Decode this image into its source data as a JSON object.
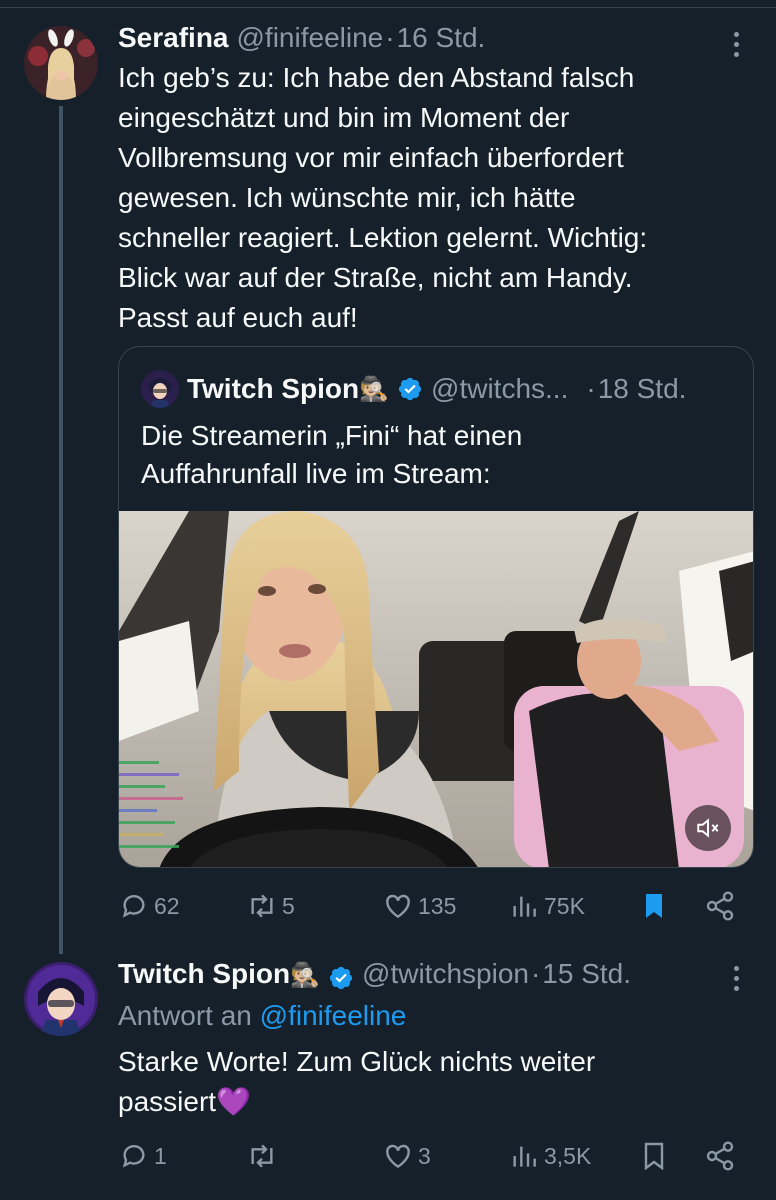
{
  "main_tweet": {
    "name": "Serafina",
    "handle": "@finifeeline",
    "sep": "·",
    "time": "16 Std.",
    "text_lines": [
      "Ich geb’s zu: Ich habe den Abstand falsch",
      "eingeschätzt und bin im Moment der",
      "Vollbremsung vor mir einfach überfordert",
      "gewesen. Ich wünschte mir, ich hätte",
      "schneller reagiert. Lektion gelernt. Wichtig:",
      "Blick war auf der Straße, nicht am Handy.",
      "Passt auf euch auf!"
    ],
    "quote": {
      "name": "Twitch Spion",
      "emoji": "🕵🏼",
      "handle": "@twitchs...",
      "sep": "·",
      "time": "18 Std.",
      "text_lines": [
        "Die Streamerin „Fini“ hat einen",
        "Auffahrunfall live im Stream:"
      ]
    },
    "actions": {
      "replies": "62",
      "retweets": "5",
      "likes": "135",
      "views": "75K"
    }
  },
  "reply_tweet": {
    "name": "Twitch Spion",
    "emoji": "🕵🏼",
    "handle": "@twitchspion",
    "sep": "·",
    "time": "15 Std.",
    "reply_prefix": "Antwort an",
    "reply_handle": "@finifeeline",
    "text_lines": [
      "Starke Worte! Zum Glück nichts weiter",
      "passiert💜"
    ],
    "actions": {
      "replies": "1",
      "retweets": "",
      "likes": "3",
      "views": "3,5K"
    }
  },
  "colors": {
    "background": "#15202b",
    "text": "#f7f9f9",
    "muted": "#8b98a5",
    "accent": "#1d9bf0",
    "border": "#38444d"
  },
  "icons": [
    "reply-icon",
    "retweet-icon",
    "like-icon",
    "views-icon",
    "bookmark-icon",
    "share-icon",
    "more-icon",
    "verified-icon",
    "mute-icon"
  ]
}
